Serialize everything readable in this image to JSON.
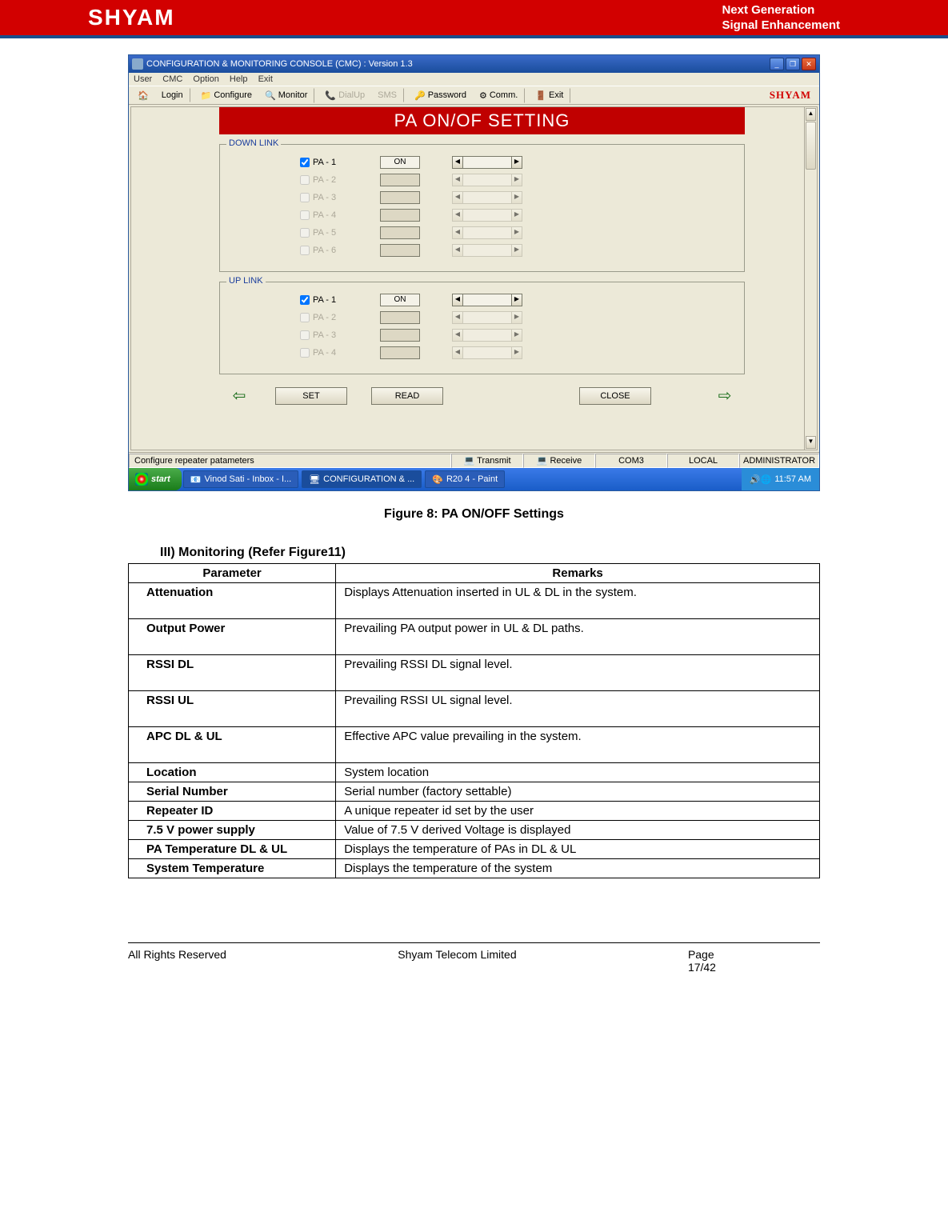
{
  "banner": {
    "logo": "SHYAM",
    "line1": "Next Generation",
    "line2": "Signal Enhancement"
  },
  "window": {
    "title": "CONFIGURATION & MONITORING CONSOLE (CMC)  :  Version 1.3",
    "menu": {
      "user": "User",
      "cmc": "CMC",
      "option": "Option",
      "help": "Help",
      "exit": "Exit"
    },
    "toolbar": {
      "login": "Login",
      "configure": "Configure",
      "monitor": "Monitor",
      "dialup": "DialUp",
      "sms": "SMS",
      "password": "Password",
      "comm": "Comm.",
      "exit": "Exit",
      "brand": "SHYAM"
    },
    "pa_title": "PA ON/OF SETTING",
    "downlink": {
      "label": "DOWN LINK",
      "rows": [
        {
          "name": "PA - 1",
          "checked": true,
          "status": "ON",
          "enabled": true
        },
        {
          "name": "PA - 2",
          "checked": false,
          "status": "",
          "enabled": false
        },
        {
          "name": "PA - 3",
          "checked": false,
          "status": "",
          "enabled": false
        },
        {
          "name": "PA - 4",
          "checked": false,
          "status": "",
          "enabled": false
        },
        {
          "name": "PA - 5",
          "checked": false,
          "status": "",
          "enabled": false
        },
        {
          "name": "PA - 6",
          "checked": false,
          "status": "",
          "enabled": false
        }
      ]
    },
    "uplink": {
      "label": "UP LINK",
      "rows": [
        {
          "name": "PA - 1",
          "checked": true,
          "status": "ON",
          "enabled": true
        },
        {
          "name": "PA - 2",
          "checked": false,
          "status": "",
          "enabled": false
        },
        {
          "name": "PA - 3",
          "checked": false,
          "status": "",
          "enabled": false
        },
        {
          "name": "PA - 4",
          "checked": false,
          "status": "",
          "enabled": false
        }
      ]
    },
    "buttons": {
      "set": "SET",
      "read": "READ",
      "close": "CLOSE"
    },
    "status": {
      "msg": "Configure repeater patameters",
      "transmit": "Transmit",
      "receive": "Receive",
      "com": "COM3",
      "local": "LOCAL",
      "admin": "ADMINISTRATOR"
    },
    "taskbar": {
      "start": "start",
      "item1": "Vinod Sati - Inbox - I...",
      "item2": "CONFIGURATION & ...",
      "item3": "R20 4 - Paint",
      "time": "11:57 AM"
    }
  },
  "figure_caption": "Figure 8: PA ON/OFF Settings",
  "section_heading": "III) Monitoring (Refer Figure11)",
  "table": {
    "h1": "Parameter",
    "h2": "Remarks",
    "rows": [
      {
        "p": "Attenuation",
        "r": "Displays Attenuation inserted in UL & DL in the system.",
        "tall": true
      },
      {
        "p": "Output Power",
        "r": "Prevailing PA output power in UL & DL paths.",
        "tall": true
      },
      {
        "p": "RSSI DL",
        "r": "Prevailing RSSI DL signal level.",
        "tall": true
      },
      {
        "p": "RSSI UL",
        "r": "Prevailing RSSI UL signal level.",
        "tall": true
      },
      {
        "p": "APC DL & UL",
        "r": "Effective APC value prevailing in the system.",
        "tall": true
      },
      {
        "p": "Location",
        "r": "System location",
        "tall": false
      },
      {
        "p": "Serial Number",
        "r": "Serial number (factory settable)",
        "tall": false
      },
      {
        "p": "Repeater ID",
        "r": "A unique repeater id set by the user",
        "tall": false
      },
      {
        "p": "7.5 V power supply",
        "r": "Value of 7.5 V derived Voltage is displayed",
        "tall": false
      },
      {
        "p": "PA Temperature DL & UL",
        "r": "Displays the temperature of PAs in DL & UL",
        "tall": false
      },
      {
        "p": "System Temperature",
        "r": "Displays the temperature of the system",
        "tall": false
      }
    ]
  },
  "footer": {
    "left": "All Rights Reserved",
    "center": "Shyam Telecom Limited",
    "page_label": "Page",
    "page_num": "17/42"
  }
}
